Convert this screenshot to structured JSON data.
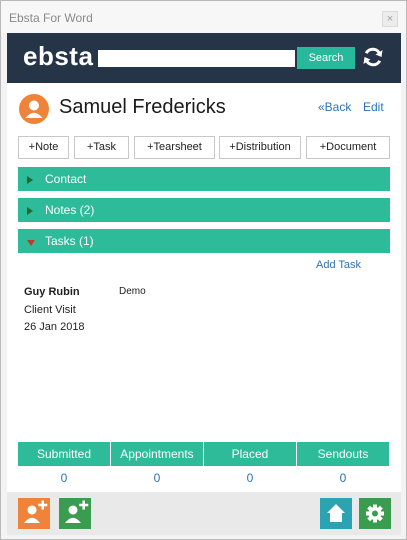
{
  "window": {
    "title": "Ebsta For Word",
    "close_glyph": "×"
  },
  "header": {
    "logo": "ebsta",
    "search": {
      "value": "",
      "placeholder": "",
      "button_label": "Search"
    },
    "refresh_icon": "refresh-icon"
  },
  "contact": {
    "name": "Samuel Fredericks",
    "back_label": "«Back",
    "edit_label": "Edit",
    "avatar_icon": "person-icon",
    "avatar_color": "#f0833a"
  },
  "actions": [
    "+Note",
    "+Task",
    "+Tearsheet",
    "+Distribution",
    "+Document"
  ],
  "sections": {
    "contact": {
      "label": "Contact",
      "expanded": false
    },
    "notes": {
      "label": "Notes (2)",
      "expanded": false
    },
    "tasks": {
      "label": "Tasks (1)",
      "expanded": true
    }
  },
  "tasks": {
    "add_label": "Add Task",
    "items": [
      {
        "person": "Guy Rubin",
        "tag": "Demo",
        "type": "Client Visit",
        "date": "26 Jan 2018"
      }
    ]
  },
  "stats": [
    {
      "label": "Submitted",
      "value": "0"
    },
    {
      "label": "Appointments",
      "value": "0"
    },
    {
      "label": "Placed",
      "value": "0"
    },
    {
      "label": "Sendouts",
      "value": "0"
    }
  ],
  "footer": {
    "add_contact_orange_icon": "add-contact-icon",
    "add_contact_green_icon": "add-contact-icon",
    "home_icon": "home-icon",
    "settings_icon": "gear-icon"
  },
  "colors": {
    "accent": "#2dbb99",
    "header_bg": "#263447",
    "link": "#2a74b6",
    "orange": "#f0833a",
    "green": "#3a9c4f",
    "teal": "#2aa3b3"
  }
}
